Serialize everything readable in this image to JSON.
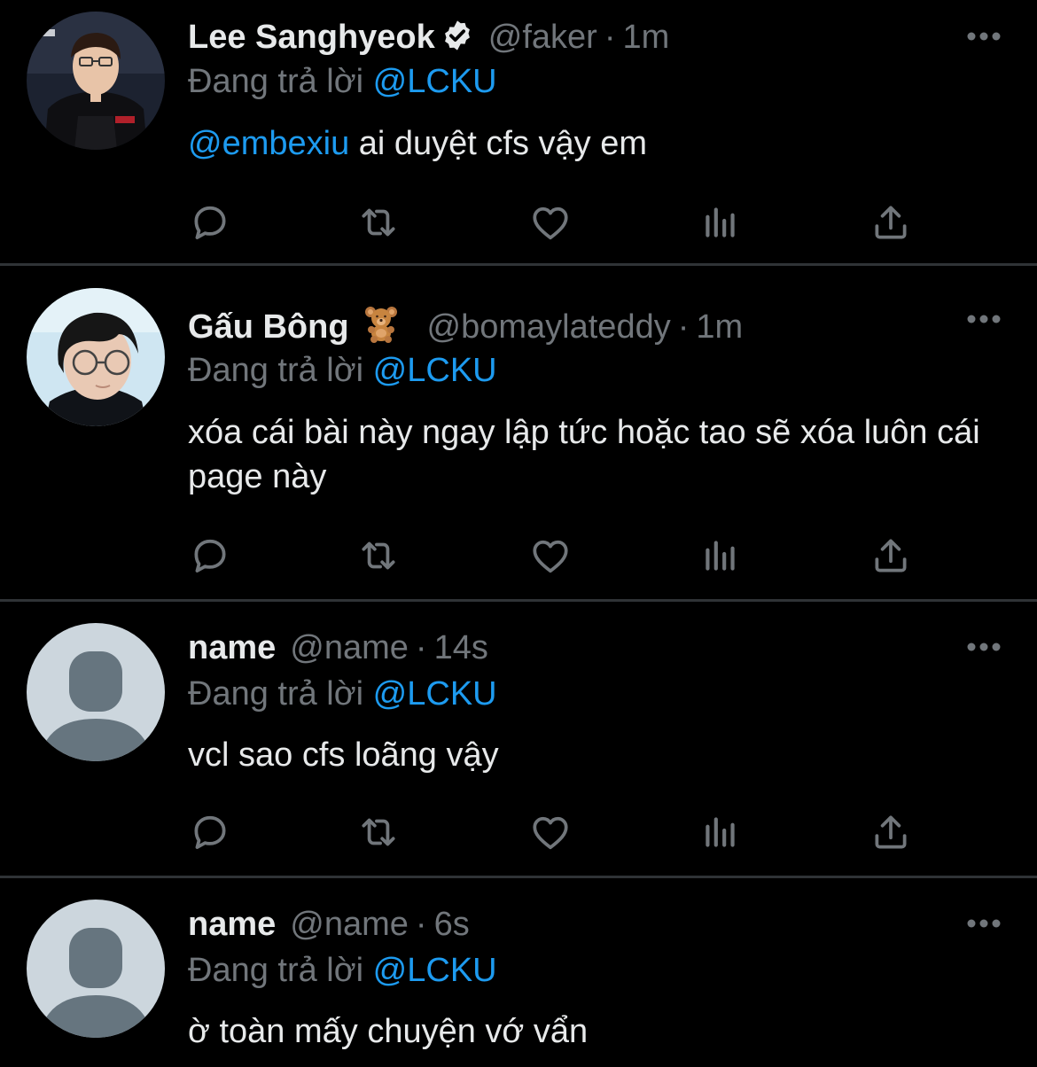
{
  "tweets": [
    {
      "display_name": "Lee Sanghyeok",
      "verified": true,
      "handle": "@faker",
      "dot": "·",
      "time": "1m",
      "reply_prefix": "Đang trả lời",
      "reply_to": "@LCKU",
      "mention": "@embexiu",
      "text": " ai duyệt cfs vậy em",
      "avatar": "photo-person-esports-jersey"
    },
    {
      "display_name": "Gấu Bông",
      "emoji": "teddy-bear-emoji",
      "handle": "@bomaylateddy",
      "dot": "·",
      "time": "1m",
      "reply_prefix": "Đang trả lời",
      "reply_to": "@LCKU",
      "text": "xóa cái bài này ngay lập tức hoặc tao sẽ xóa luôn cái page này",
      "avatar": "photo-person-glasses"
    },
    {
      "display_name": "name",
      "handle": "@name",
      "dot": "·",
      "time": "14s",
      "reply_prefix": "Đang trả lời",
      "reply_to": "@LCKU",
      "text": "vcl sao cfs loãng vậy",
      "avatar": "default-avatar"
    },
    {
      "display_name": "name",
      "handle": "@name",
      "dot": "·",
      "time": "6s",
      "reply_prefix": "Đang trả lời",
      "reply_to": "@LCKU",
      "text": "ờ toàn mấy chuyện vớ vẩn",
      "avatar": "default-avatar"
    }
  ],
  "icons": {
    "more": "more-horizontal-icon",
    "reply": "reply-icon",
    "retweet": "retweet-icon",
    "like": "like-icon",
    "views": "views-icon",
    "share": "share-icon"
  },
  "colors": {
    "background": "#000000",
    "text": "#e7e9ea",
    "secondary": "#71767b",
    "accent": "#1d9bf0",
    "divider": "#2f3336",
    "default_avatar_bg": "#ccd6dd",
    "default_avatar_fg": "#66757f"
  }
}
